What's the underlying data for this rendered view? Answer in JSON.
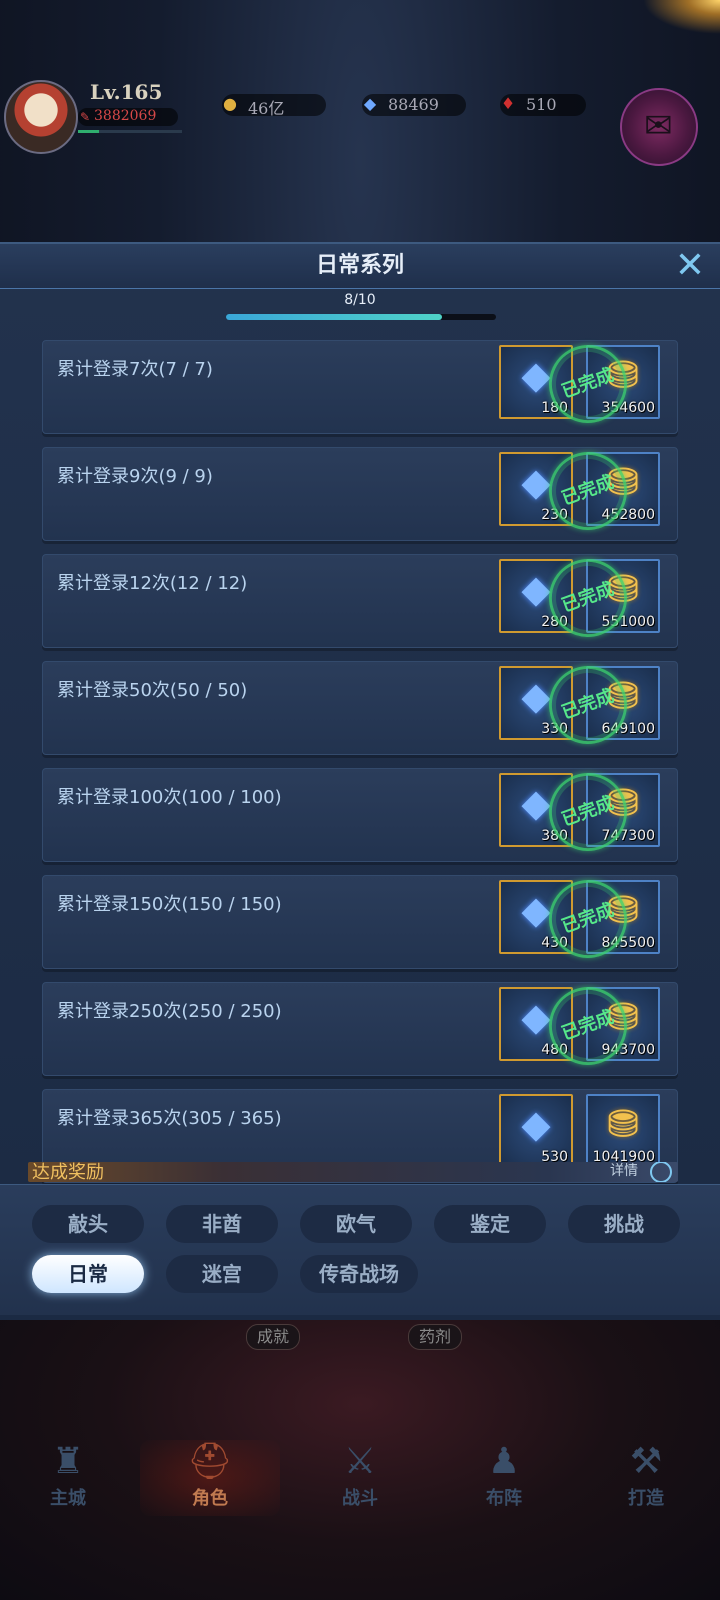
{
  "hud": {
    "level": "Lv.165",
    "power": "3882069",
    "gold": "46亿",
    "diamond": "88469",
    "ruby": "510"
  },
  "panel": {
    "title": "日常系列",
    "progress_text": "8/10",
    "progress_fraction": 0.8,
    "stamp_text": "已完成",
    "tasks": [
      {
        "label": "累计登录7次(7 / 7)",
        "gem_qty": "180",
        "gold_qty": "354600",
        "completed": true
      },
      {
        "label": "累计登录9次(9 / 9)",
        "gem_qty": "230",
        "gold_qty": "452800",
        "completed": true
      },
      {
        "label": "累计登录12次(12 / 12)",
        "gem_qty": "280",
        "gold_qty": "551000",
        "completed": true
      },
      {
        "label": "累计登录50次(50 / 50)",
        "gem_qty": "330",
        "gold_qty": "649100",
        "completed": true
      },
      {
        "label": "累计登录100次(100 / 100)",
        "gem_qty": "380",
        "gold_qty": "747300",
        "completed": true
      },
      {
        "label": "累计登录150次(150 / 150)",
        "gem_qty": "430",
        "gold_qty": "845500",
        "completed": true
      },
      {
        "label": "累计登录250次(250 / 250)",
        "gem_qty": "480",
        "gold_qty": "943700",
        "completed": true
      },
      {
        "label": "累计登录365次(305 / 365)",
        "gem_qty": "530",
        "gold_qty": "1041900",
        "completed": false
      }
    ],
    "bottom_strip_left": "达成奖励",
    "bottom_strip_right": "详情"
  },
  "tabs": [
    "敲头",
    "非酋",
    "欧气",
    "鉴定",
    "挑战",
    "日常",
    "迷宫",
    "传奇战场"
  ],
  "active_tab": "日常",
  "sub_buttons": [
    "成就",
    "药剂"
  ],
  "nav": [
    {
      "label": "主城",
      "icon": "castle-icon"
    },
    {
      "label": "角色",
      "icon": "helmet-icon"
    },
    {
      "label": "战斗",
      "icon": "crossed-swords-icon"
    },
    {
      "label": "布阵",
      "icon": "formation-icon"
    },
    {
      "label": "打造",
      "icon": "anvil-icon"
    }
  ],
  "active_nav": "角色",
  "colors": {
    "accent": "#4fd3c8",
    "stamp": "#3cd26e",
    "gem_border": "#d09a30",
    "gold_border": "#4e82c6"
  }
}
